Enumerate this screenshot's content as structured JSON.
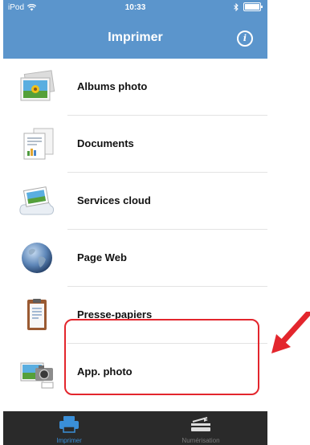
{
  "status_bar": {
    "carrier": "iPod",
    "time": "10:33"
  },
  "header": {
    "title": "Imprimer"
  },
  "menu": {
    "items": [
      {
        "label": "Albums photo",
        "icon": "photo-album-icon"
      },
      {
        "label": "Documents",
        "icon": "documents-icon"
      },
      {
        "label": "Services cloud",
        "icon": "cloud-services-icon"
      },
      {
        "label": "Page Web",
        "icon": "globe-icon"
      },
      {
        "label": "Presse-papiers",
        "icon": "clipboard-icon"
      },
      {
        "label": "App. photo",
        "icon": "camera-icon"
      }
    ]
  },
  "tabbar": {
    "tabs": [
      {
        "label": "Imprimer",
        "icon": "printer-icon",
        "active": true
      },
      {
        "label": "Numérisation",
        "icon": "scanner-icon",
        "active": false
      }
    ]
  },
  "colors": {
    "header": "#5b95cc",
    "tabbar": "#2a2a2a",
    "active_tab": "#3a8fd8",
    "highlight": "#e3262d"
  }
}
